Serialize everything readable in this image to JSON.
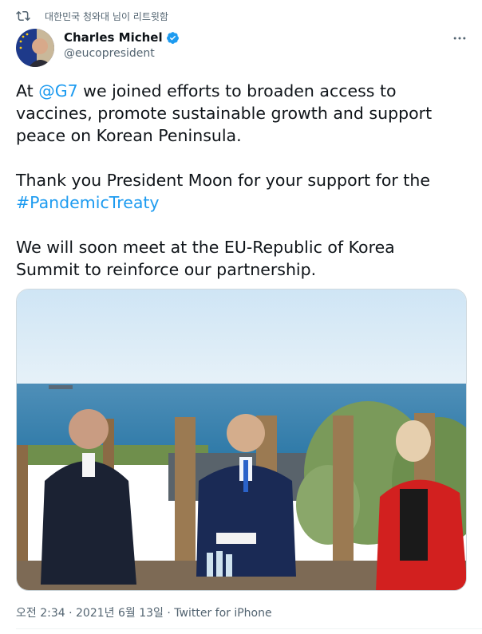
{
  "retweet": {
    "text": "대한민국 청와대 님이 리트윗함"
  },
  "author": {
    "display_name": "Charles Michel",
    "handle": "@eucopresident",
    "verified": true
  },
  "tweet": {
    "p1_mention": "@G7",
    "p1_rest": " we joined efforts to broaden access to vaccines, promote sustainable growth and support peace on Korean Peninsula.",
    "p1_prefix": "At ",
    "p2_text": "Thank you President Moon for your support for the ",
    "p2_hashtag": "#PandemicTreaty",
    "p3_text": "We will soon meet at the EU-Republic of Korea Summit to reinforce our partnership."
  },
  "meta": {
    "time": "오전 2:34",
    "date": "2021년 6월 13일",
    "source": "Twitter for iPhone",
    "separator": "·"
  },
  "icons": {
    "retweet": "retweet-icon",
    "verified": "verified-badge-icon",
    "more": "more-options-icon"
  },
  "colors": {
    "link": "#1d9bf0",
    "secondary": "#536471",
    "verified": "#1d9bf0"
  }
}
